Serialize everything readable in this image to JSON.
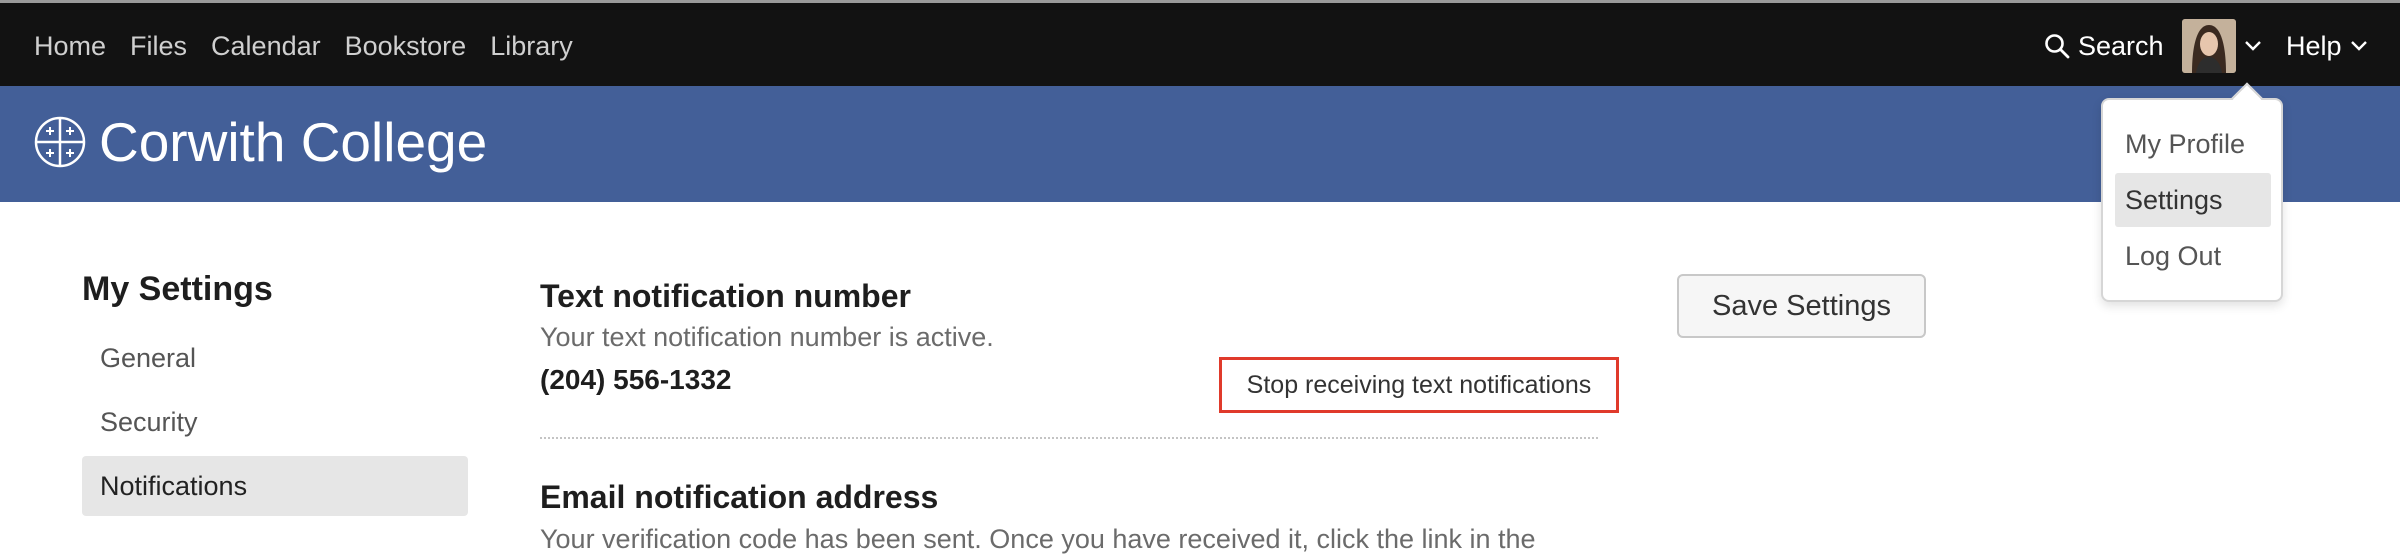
{
  "nav": {
    "links": [
      "Home",
      "Files",
      "Calendar",
      "Bookstore",
      "Library"
    ],
    "search_label": "Search",
    "help_label": "Help"
  },
  "banner": {
    "college_name": "Corwith College"
  },
  "user_menu": {
    "items": [
      "My Profile",
      "Settings",
      "Log Out"
    ],
    "selected": "Settings"
  },
  "sidebar": {
    "title": "My Settings",
    "items": [
      "General",
      "Security",
      "Notifications"
    ],
    "selected": "Notifications"
  },
  "text_notification": {
    "title": "Text notification number",
    "status": "Your text notification number is active.",
    "phone": "(204) 556-1332",
    "stop_label": "Stop receiving text notifications"
  },
  "email_notification": {
    "title": "Email notification address",
    "status": "Your verification code has been sent. Once you have received it, click the link in the"
  },
  "save_label": "Save Settings",
  "colors": {
    "topbar": "#121212",
    "banner": "#435f98",
    "highlight_border": "#e03a2b",
    "active_item": "#e6e6e6"
  },
  "icons": {
    "search": "search-icon",
    "logo": "college-seal-icon",
    "chevron": "chevron-down-icon"
  }
}
